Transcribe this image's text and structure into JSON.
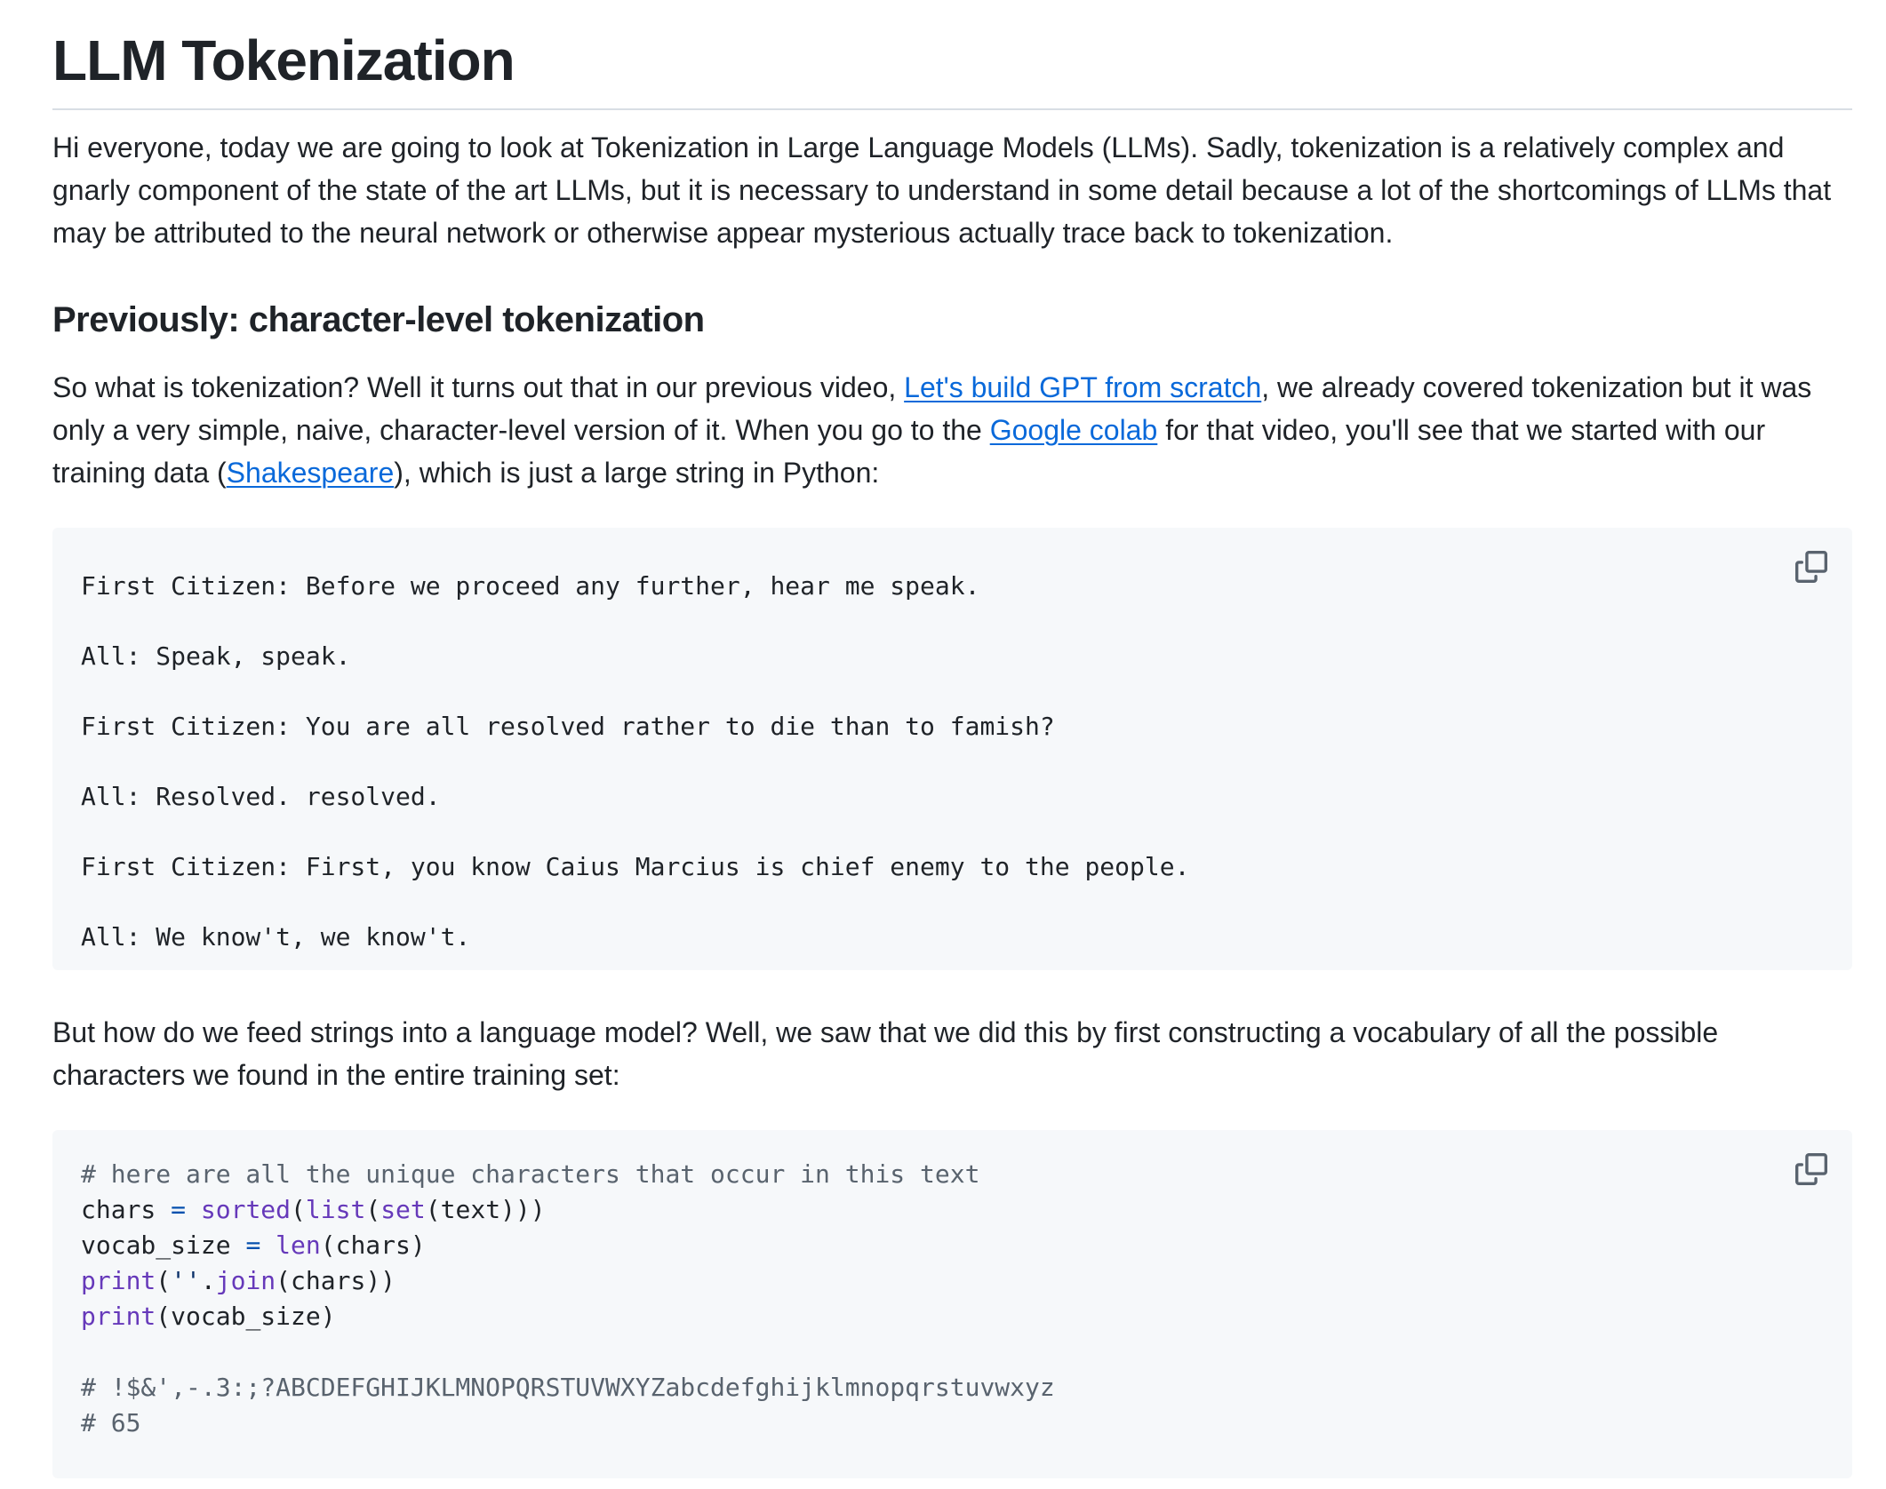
{
  "title": "LLM Tokenization",
  "intro": "Hi everyone, today we are going to look at Tokenization in Large Language Models (LLMs). Sadly, tokenization is a relatively complex and gnarly component of the state of the art LLMs, but it is necessary to understand in some detail because a lot of the shortcomings of LLMs that may be attributed to the neural network or otherwise appear mysterious actually trace back to tokenization.",
  "section_heading": "Previously: character-level tokenization",
  "previously": {
    "part1": "So what is tokenization? Well it turns out that in our previous video, ",
    "link1": "Let's build GPT from scratch",
    "part2": ", we already covered tokenization but it was only a very simple, naive, character-level version of it. When you go to the ",
    "link2": "Google colab",
    "part3": " for that video, you'll see that we started with our training data (",
    "link3": "Shakespeare",
    "part4": "), which is just a large string in Python:"
  },
  "code_block_1": {
    "lines": [
      "First Citizen: Before we proceed any further, hear me speak.",
      "All: Speak, speak.",
      "First Citizen: You are all resolved rather to die than to famish?",
      "All: Resolved. resolved.",
      "First Citizen: First, you know Caius Marcius is chief enemy to the people.",
      "All: We know't, we know't."
    ],
    "copy_icon": "copy-icon"
  },
  "feed_paragraph": "But how do we feed strings into a language model? Well, we saw that we did this by first constructing a vocabulary of all the possible characters we found in the entire training set:",
  "code_block_2": {
    "comment1": "# here are all the unique characters that occur in this text",
    "line2": {
      "a": "chars ",
      "op": "=",
      "b": " ",
      "f1": "sorted",
      "p1": "(",
      "f2": "list",
      "p2": "(",
      "f3": "set",
      "c": "(text)))"
    },
    "line3": {
      "a": "vocab_size ",
      "op": "=",
      "b": " ",
      "f1": "len",
      "c": "(chars)"
    },
    "line4": {
      "f1": "print",
      "p1": "(",
      "s": "''",
      "dot": ".",
      "f2": "join",
      "c": "(chars))"
    },
    "line5": {
      "f1": "print",
      "c": "(vocab_size)"
    },
    "out1": "# !$&',-.3:;?ABCDEFGHIJKLMNOPQRSTUVWXYZabcdefghijklmnopqrstuvwxyz",
    "out2": "# 65",
    "copy_icon": "copy-icon"
  },
  "colors": {
    "link": "#0969da",
    "code_bg": "#f6f8fa",
    "comment": "#59636e",
    "builtin": "#6639ba"
  }
}
